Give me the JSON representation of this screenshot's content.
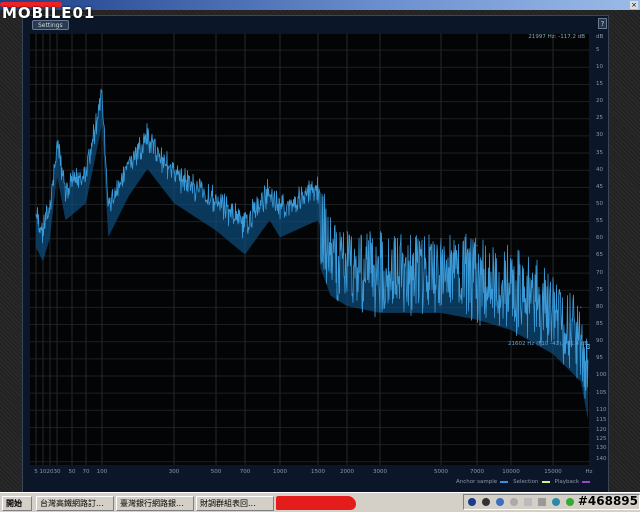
{
  "window": {
    "logo": "MOBILE01",
    "settings_label": "Settings",
    "help_label": "?",
    "close_label": "×"
  },
  "readouts": {
    "cursor": "21997 Hz: -117.2 dB",
    "marker": "21602 Hz (F10 -43), -91.4 dB"
  },
  "db_axis": {
    "unit": "dB",
    "labels": [
      "5",
      "10",
      "15",
      "20",
      "25",
      "30",
      "35",
      "40",
      "45",
      "50",
      "55",
      "60",
      "65",
      "70",
      "75",
      "80",
      "85",
      "90",
      "95",
      "100",
      "105",
      "110",
      "115",
      "120",
      "125",
      "130",
      "140"
    ]
  },
  "freq_axis": {
    "unit": "Hz",
    "labels": [
      "5",
      "10",
      "20",
      "30",
      "50",
      "70",
      "100",
      "300",
      "500",
      "700",
      "1000",
      "1500",
      "2000",
      "3000",
      "5000",
      "7000",
      "10000",
      "15000"
    ]
  },
  "legend": [
    {
      "label": "Anchor sample",
      "color": "#3a8ee0"
    },
    {
      "label": "Selection",
      "color": "#d8f07a"
    },
    {
      "label": "Playback",
      "color": "#a040d0"
    }
  ],
  "chart_data": {
    "type": "line",
    "xlabel": "Hz",
    "ylabel": "dB",
    "xscale": "log",
    "ylim": [
      -140,
      0
    ],
    "x": [
      5,
      10,
      20,
      30,
      40,
      70,
      100,
      110,
      150,
      200,
      300,
      500,
      700,
      900,
      1000,
      1500,
      1700,
      2000,
      3000,
      5000,
      7000,
      10000,
      15000,
      20000,
      21600
    ],
    "y": [
      -53,
      -57,
      -50,
      -32,
      -45,
      -40,
      -17,
      -50,
      -38,
      -30,
      -40,
      -48,
      -55,
      -45,
      -50,
      -45,
      -55,
      -58,
      -60,
      -60,
      -62,
      -65,
      -72,
      -80,
      -91.4
    ],
    "color": "#3a9ad8"
  },
  "taskbar": {
    "start": "開始",
    "tasks": [
      "台灣高鐵網路訂...",
      "臺灣銀行網路銀...",
      "財調群組表回..."
    ],
    "watermark": "#468895"
  }
}
